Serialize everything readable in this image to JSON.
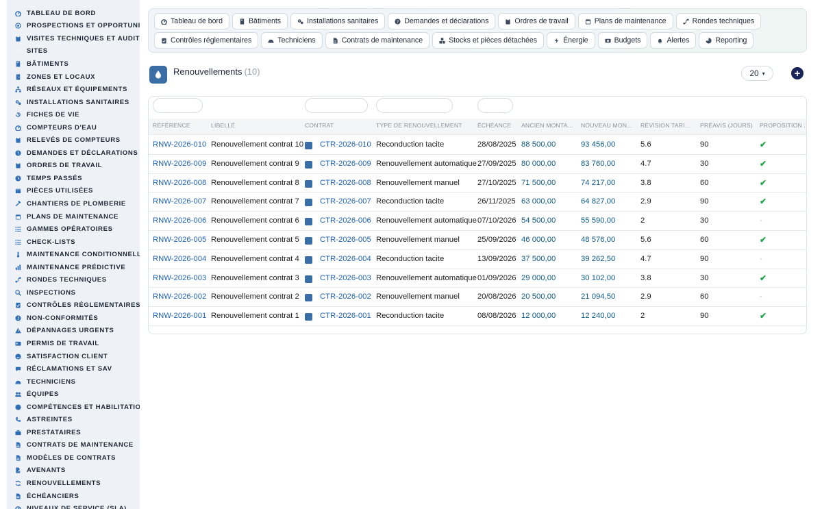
{
  "sidebar": {
    "items": [
      {
        "label": "TABLEAU DE BORD",
        "icon": "gauge-icon"
      },
      {
        "label": "PROSPECTIONS ET OPPORTUNITÉS",
        "icon": "target-icon"
      },
      {
        "label": "VISITES TECHNIQUES ET AUDITS",
        "icon": "clipboard-icon"
      },
      {
        "label": "SITES",
        "icon": "map-pin-icon"
      },
      {
        "label": "BÂTIMENTS",
        "icon": "building-icon"
      },
      {
        "label": "ZONES ET LOCAUX",
        "icon": "door-icon"
      },
      {
        "label": "RÉSEAUX ET ÉQUIPEMENTS",
        "icon": "network-icon"
      },
      {
        "label": "INSTALLATIONS SANITAIRES",
        "icon": "gears-icon"
      },
      {
        "label": "FICHES DE VIE",
        "icon": "history-icon"
      },
      {
        "label": "COMPTEURS D'EAU",
        "icon": "gauge-icon"
      },
      {
        "label": "RELEVÉS DE COMPTEURS",
        "icon": "clipboard-icon"
      },
      {
        "label": "DEMANDES ET DÉCLARATIONS",
        "icon": "question-circle-icon"
      },
      {
        "label": "ORDRES DE TRAVAIL",
        "icon": "clipboard-icon"
      },
      {
        "label": "TEMPS PASSÉS",
        "icon": "clock-icon"
      },
      {
        "label": "PIÈCES UTILISÉES",
        "icon": "box-icon"
      },
      {
        "label": "CHANTIERS DE PLOMBERIE",
        "icon": "hammer-icon"
      },
      {
        "label": "PLANS DE MAINTENANCE",
        "icon": "calendar-icon"
      },
      {
        "label": "GAMMES OPÉRATOIRES",
        "icon": "list-icon"
      },
      {
        "label": "CHECK-LISTS",
        "icon": "list-icon"
      },
      {
        "label": "MAINTENANCE CONDITIONNELLE",
        "icon": "thermometer-icon"
      },
      {
        "label": "MAINTENANCE PRÉDICTIVE",
        "icon": "chart-icon"
      },
      {
        "label": "RONDES TECHNIQUES",
        "icon": "route-icon"
      },
      {
        "label": "INSPECTIONS",
        "icon": "search-icon"
      },
      {
        "label": "CONTRÔLES RÉGLEMENTAIRES",
        "icon": "clipboard-check-icon"
      },
      {
        "label": "NON-CONFORMITÉS",
        "icon": "alert-circle-icon"
      },
      {
        "label": "DÉPANNAGES URGENTS",
        "icon": "warning-icon"
      },
      {
        "label": "PERMIS DE TRAVAIL",
        "icon": "id-card-icon"
      },
      {
        "label": "SATISFACTION CLIENT",
        "icon": "smile-icon"
      },
      {
        "label": "RÉCLAMATIONS ET SAV",
        "icon": "comment-icon"
      },
      {
        "label": "TECHNICIENS",
        "icon": "helmet-icon"
      },
      {
        "label": "ÉQUIPES",
        "icon": "users-icon"
      },
      {
        "label": "COMPÉTENCES ET HABILITATIONS",
        "icon": "certificate-icon"
      },
      {
        "label": "ASTREINTES",
        "icon": "phone-icon"
      },
      {
        "label": "PRESTATAIRES",
        "icon": "briefcase-icon"
      },
      {
        "label": "CONTRATS DE MAINTENANCE",
        "icon": "file-icon"
      },
      {
        "label": "MODÈLES DE CONTRATS",
        "icon": "file-icon"
      },
      {
        "label": "AVENANTS",
        "icon": "file-edit-icon"
      },
      {
        "label": "RENOUVELLEMENTS",
        "icon": "refresh-icon"
      },
      {
        "label": "ÉCHÉANCIERS",
        "icon": "file-icon"
      },
      {
        "label": "NIVEAUX DE SERVICE (SLA)",
        "icon": "gauge-icon"
      }
    ]
  },
  "topnav": {
    "row1": [
      {
        "label": "Tableau de bord",
        "icon": "gauge-icon"
      },
      {
        "label": "Bâtiments",
        "icon": "building-icon"
      },
      {
        "label": "Installations sanitaires",
        "icon": "gears-icon"
      },
      {
        "label": "Demandes et déclarations",
        "icon": "question-circle-icon"
      },
      {
        "label": "Ordres de travail",
        "icon": "clipboard-icon"
      },
      {
        "label": "Plans de maintenance",
        "icon": "calendar-icon"
      },
      {
        "label": "Rondes techniques",
        "icon": "route-icon"
      }
    ],
    "row2": [
      {
        "label": "Contrôles réglementaires",
        "icon": "clipboard-check-icon"
      },
      {
        "label": "Techniciens",
        "icon": "helmet-icon"
      },
      {
        "label": "Contrats de maintenance",
        "icon": "file-icon"
      },
      {
        "label": "Stocks et pièces détachées",
        "icon": "boxes-icon"
      },
      {
        "label": "Énergie",
        "icon": "bolt-icon"
      },
      {
        "label": "Budgets",
        "icon": "money-icon"
      },
      {
        "label": "Alertes",
        "icon": "bell-icon"
      },
      {
        "label": "Reporting",
        "icon": "pie-icon"
      }
    ]
  },
  "page": {
    "title": "Renouvellements",
    "count": "(10)",
    "per_page": "20",
    "add_label": "+"
  },
  "table": {
    "columns": [
      "RÉFÉRENCE",
      "LIBELLÉ",
      "CONTRAT",
      "TYPE DE RENOUVELLEMENT",
      "ÉCHÉANCE",
      "ANCIEN MONTA...",
      "NOUVEAU MON...",
      "RÉVISION TARI...",
      "PRÉAVIS (JOURS)",
      "PROPOSITION ..."
    ],
    "rows": [
      {
        "ref": "RNW-2026-010",
        "label": "Renouvellement contrat 10",
        "contract": "CTR-2026-010",
        "type": "Reconduction tacite",
        "due": "28/08/2025",
        "old": "88 500,00",
        "new": "93 456,00",
        "rev": "5.6",
        "notice": "90",
        "proposal": "✔"
      },
      {
        "ref": "RNW-2026-009",
        "label": "Renouvellement contrat 9",
        "contract": "CTR-2026-009",
        "type": "Renouvellement automatique",
        "due": "27/09/2025",
        "old": "80 000,00",
        "new": "83 760,00",
        "rev": "4.7",
        "notice": "30",
        "proposal": "✔"
      },
      {
        "ref": "RNW-2026-008",
        "label": "Renouvellement contrat 8",
        "contract": "CTR-2026-008",
        "type": "Renouvellement manuel",
        "due": "27/10/2025",
        "old": "71 500,00",
        "new": "74 217,00",
        "rev": "3.8",
        "notice": "60",
        "proposal": "✔"
      },
      {
        "ref": "RNW-2026-007",
        "label": "Renouvellement contrat 7",
        "contract": "CTR-2026-007",
        "type": "Reconduction tacite",
        "due": "26/11/2025",
        "old": "63 000,00",
        "new": "64 827,00",
        "rev": "2.9",
        "notice": "90",
        "proposal": "✔"
      },
      {
        "ref": "RNW-2026-006",
        "label": "Renouvellement contrat 6",
        "contract": "CTR-2026-006",
        "type": "Renouvellement automatique",
        "due": "07/10/2026",
        "old": "54 500,00",
        "new": "55 590,00",
        "rev": "2",
        "notice": "30",
        "proposal": "-"
      },
      {
        "ref": "RNW-2026-005",
        "label": "Renouvellement contrat 5",
        "contract": "CTR-2026-005",
        "type": "Renouvellement manuel",
        "due": "25/09/2026",
        "old": "46 000,00",
        "new": "48 576,00",
        "rev": "5.6",
        "notice": "60",
        "proposal": "✔"
      },
      {
        "ref": "RNW-2026-004",
        "label": "Renouvellement contrat 4",
        "contract": "CTR-2026-004",
        "type": "Reconduction tacite",
        "due": "13/09/2026",
        "old": "37 500,00",
        "new": "39 262,50",
        "rev": "4.7",
        "notice": "90",
        "proposal": "-"
      },
      {
        "ref": "RNW-2026-003",
        "label": "Renouvellement contrat 3",
        "contract": "CTR-2026-003",
        "type": "Renouvellement automatique",
        "due": "01/09/2026",
        "old": "29 000,00",
        "new": "30 102,00",
        "rev": "3.8",
        "notice": "30",
        "proposal": "✔"
      },
      {
        "ref": "RNW-2026-002",
        "label": "Renouvellement contrat 2",
        "contract": "CTR-2026-002",
        "type": "Renouvellement manuel",
        "due": "20/08/2026",
        "old": "20 500,00",
        "new": "21 094,50",
        "rev": "2.9",
        "notice": "60",
        "proposal": "-"
      },
      {
        "ref": "RNW-2026-001",
        "label": "Renouvellement contrat 1",
        "contract": "CTR-2026-001",
        "type": "Reconduction tacite",
        "due": "08/08/2026",
        "old": "12 000,00",
        "new": "12 240,00",
        "rev": "2",
        "notice": "90",
        "proposal": "✔"
      }
    ]
  },
  "colors": {
    "accent": "#1f62b3",
    "amount": "#0d5a86",
    "check": "#22a64a",
    "sidebar_bg": "#eef2f7",
    "icon": "#3a6ea5"
  }
}
